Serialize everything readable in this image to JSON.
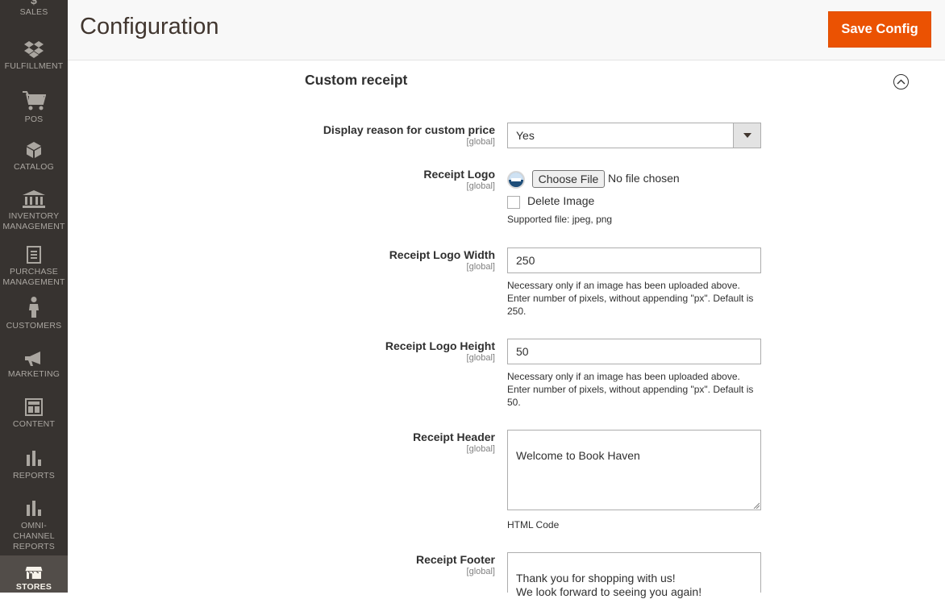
{
  "sidebar": {
    "items": [
      {
        "label": "Sales",
        "icon": "dollar-icon"
      },
      {
        "label": "Fulfillment",
        "icon": "dropbox-icon"
      },
      {
        "label": "POS",
        "icon": "cart-icon"
      },
      {
        "label": "Catalog",
        "icon": "cube-icon"
      },
      {
        "label": "Inventory Management",
        "label_line1": "Inventory",
        "label_line2": "Management",
        "icon": "bank-icon"
      },
      {
        "label": "Purchase Management",
        "label_line1": "Purchase",
        "label_line2": "Management",
        "icon": "document-icon"
      },
      {
        "label": "Customers",
        "icon": "person-icon"
      },
      {
        "label": "Marketing",
        "icon": "megaphone-icon"
      },
      {
        "label": "Content",
        "icon": "layout-icon"
      },
      {
        "label": "Reports",
        "icon": "bar-chart-icon"
      },
      {
        "label": "Omni-Channel Reports",
        "label_line1": "Omni-",
        "label_line2": "Channel",
        "label_line3": "Reports",
        "icon": "bar-chart-icon"
      },
      {
        "label": "Stores",
        "icon": "storefront-icon"
      }
    ]
  },
  "header": {
    "title": "Configuration",
    "save_label": "Save Config"
  },
  "section": {
    "title": "Custom receipt"
  },
  "fields": {
    "display_reason": {
      "label": "Display reason for custom price",
      "scope": "[global]",
      "value": "Yes"
    },
    "receipt_logo": {
      "label": "Receipt Logo",
      "scope": "[global]",
      "choose_label": "Choose File",
      "no_file": "No file chosen",
      "delete_label": "Delete Image",
      "note": "Supported file: jpeg, png"
    },
    "logo_width": {
      "label": "Receipt Logo Width",
      "scope": "[global]",
      "value": "250",
      "note": "Necessary only if an image has been uploaded above. Enter number of pixels, without appending \"px\". Default is 250."
    },
    "logo_height": {
      "label": "Receipt Logo Height",
      "scope": "[global]",
      "value": "50",
      "note": "Necessary only if an image has been uploaded above. Enter number of pixels, without appending \"px\". Default is 50."
    },
    "receipt_header": {
      "label": "Receipt Header",
      "scope": "[global]",
      "value": "Welcome to Book Haven",
      "note": "HTML Code"
    },
    "receipt_footer": {
      "label": "Receipt Footer",
      "scope": "[global]",
      "value": "Thank you for shopping with us!\nWe look forward to seeing you again!"
    }
  }
}
